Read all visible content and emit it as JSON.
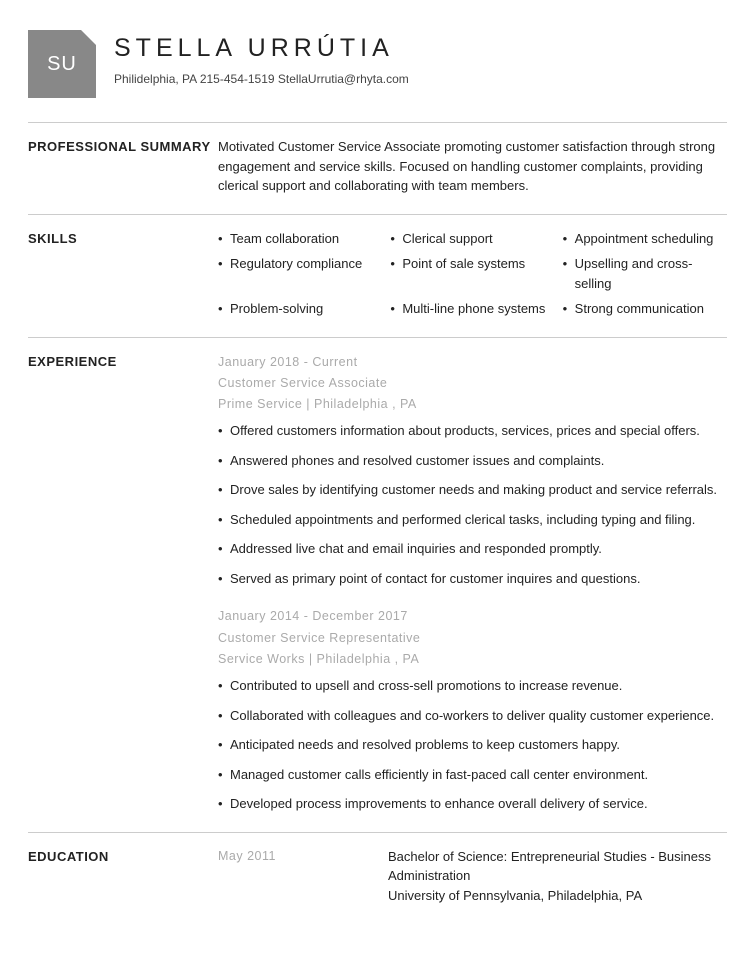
{
  "header": {
    "initials": "SU",
    "name": "STELLA URRÚTIA",
    "contact": "Philidelphia, PA 215-454-1519 StellaUrrutia@rhyta.com"
  },
  "sections": {
    "summary": {
      "label": "PROFESSIONAL SUMMARY",
      "text": "Motivated Customer Service Associate promoting customer satisfaction through strong engagement and service skills. Focused on handling customer complaints, providing clerical support and collaborating with team members."
    },
    "skills": {
      "label": "SKILLS",
      "items": [
        "Team collaboration",
        "Clerical support",
        "Appointment scheduling",
        "Regulatory compliance",
        "Point of sale systems",
        "Upselling and cross-selling",
        "Problem-solving",
        "Multi-line phone systems",
        "Strong communication"
      ]
    },
    "experience": {
      "label": "EXPERIENCE",
      "jobs": [
        {
          "dates": "January 2018 - Current",
          "title": "Customer Service Associate",
          "company": "Prime Service | Philadelphia , PA",
          "bullets": [
            "Offered customers information about products, services, prices and special offers.",
            "Answered phones and resolved customer issues and complaints.",
            "Drove sales by identifying customer needs and making product and service referrals.",
            "Scheduled appointments and performed clerical tasks, including typing and filing.",
            "Addressed live chat and email inquiries and responded promptly.",
            "Served as primary point of contact for customer inquires and questions."
          ]
        },
        {
          "dates": "January 2014 - December 2017",
          "title": "Customer Service Representative",
          "company": "Service Works | Philadelphia , PA",
          "bullets": [
            "Contributed to upsell and cross-sell promotions to increase revenue.",
            "Collaborated with colleagues and co-workers to deliver quality customer experience.",
            "Anticipated needs and resolved problems to keep customers happy.",
            "Managed customer calls efficiently in fast-paced call center environment.",
            "Developed process improvements to enhance overall delivery of service."
          ]
        }
      ]
    },
    "education": {
      "label": "EDUCATION",
      "date": "May 2011",
      "degree": "Bachelor of Science: Entrepreneurial Studies - Business Administration",
      "school": "University of Pennsylvania, Philadelphia, PA"
    }
  }
}
